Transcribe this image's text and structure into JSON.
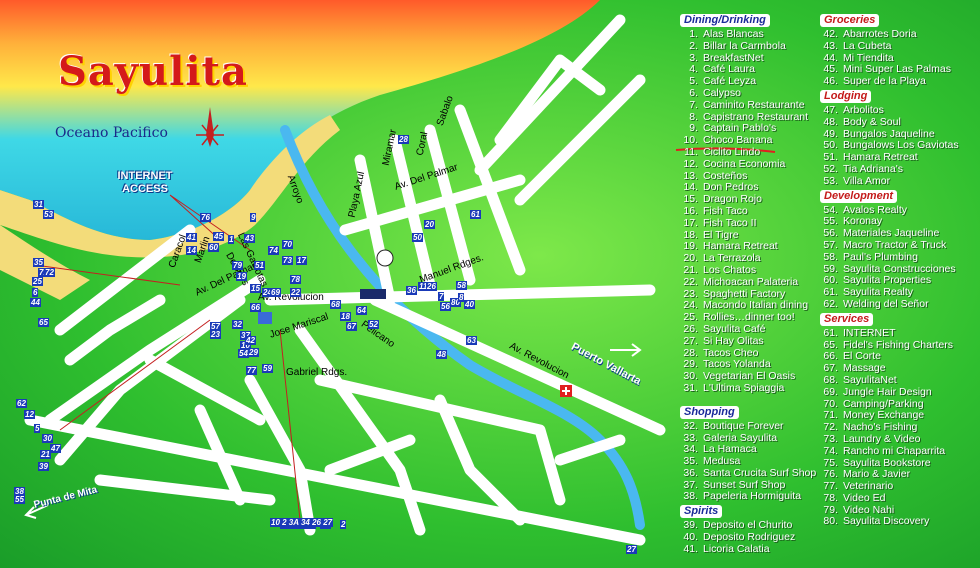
{
  "map": {
    "title": "Sayulita",
    "ocean_label": "Oceano Pacifico",
    "internet_label_line1": "INTERNET",
    "internet_label_line2": "ACCESS",
    "streets": {
      "caracol": "Caracol",
      "marlin": "Marlin",
      "las_gaviotas": "Las Gaviotas",
      "delfines": "Delfines",
      "av_del_palmar_west": "Av. Del Palmar",
      "av_revolucion_west": "Av. Revolucion",
      "jose_mariscal": "Jose Mariscal",
      "gabriel_rdgs": "Gabriel Rdgs.",
      "pelicano": "Pelicano",
      "manuel_rdges": "Manuel Rdges.",
      "av_revolucion_east": "Av. Revolucion",
      "av_del_palmar_east": "Av. Del Palmar",
      "playa_azul": "Playa Azul",
      "miramar": "Miramar",
      "coral": "Coral",
      "sabalo": "Sabalo",
      "arroyo": "Arroyo",
      "puerto_vallarta": "Puerto Vallarta",
      "punta_de_mita": "Punta de Mita"
    },
    "markers": [
      "31",
      "53",
      "76",
      "9",
      "70",
      "43",
      "45",
      "1",
      "35",
      "71",
      "25",
      "6",
      "44",
      "72",
      "65",
      "57",
      "23",
      "37",
      "10",
      "54",
      "62",
      "12",
      "5",
      "30",
      "47",
      "21",
      "39",
      "38",
      "55",
      "41",
      "14",
      "60",
      "79",
      "19",
      "51",
      "15",
      "24",
      "69",
      "74",
      "73",
      "17",
      "78",
      "22",
      "66",
      "32",
      "42",
      "29",
      "77",
      "68",
      "18",
      "67",
      "64",
      "52",
      "28",
      "20",
      "50",
      "7",
      "36",
      "11",
      "26",
      "56",
      "80",
      "40",
      "58",
      "8",
      "63",
      "48",
      "61",
      "59",
      "27",
      "2",
      "3",
      "34",
      "13",
      "46",
      "16"
    ],
    "bottom_markers": "10 2 3A 34 26 27"
  },
  "legend": {
    "dining_title": "Dining/Drinking",
    "dining": [
      [
        "1.",
        "Alas Blancas"
      ],
      [
        "2.",
        "Billar la Carmbola"
      ],
      [
        "3.",
        "BreakfastNet"
      ],
      [
        "4.",
        "Café Laura"
      ],
      [
        "5.",
        "Café Leyza"
      ],
      [
        "6.",
        "Calypso"
      ],
      [
        "7.",
        "Caminito Restaurante"
      ],
      [
        "8.",
        "Capistrano Restaurant"
      ],
      [
        "9.",
        "Captain Pablo's"
      ],
      [
        "10.",
        "Choco Banana"
      ],
      [
        "11.",
        "Ciclito Lindo"
      ],
      [
        "12.",
        "Cocina Economia"
      ],
      [
        "13.",
        "Costeños"
      ],
      [
        "14.",
        "Don Pedros"
      ],
      [
        "15.",
        "Dragon Rojo"
      ],
      [
        "16.",
        "Fish Taco"
      ],
      [
        "17.",
        "Fish Taco II"
      ],
      [
        "18.",
        "El Tigre"
      ],
      [
        "19.",
        "Hamara Retreat"
      ],
      [
        "20.",
        "La Terrazola"
      ],
      [
        "21.",
        "Los Chatos"
      ],
      [
        "22.",
        "Michoacan Palateria"
      ],
      [
        "23.",
        "Spaghetti Factory"
      ],
      [
        "24.",
        "Macondo Italian dining"
      ],
      [
        "25.",
        "Rollies…dinner too!"
      ],
      [
        "26.",
        "Sayulita Café"
      ],
      [
        "27.",
        "Si Hay Olitas"
      ],
      [
        "28.",
        "Tacos Cheo"
      ],
      [
        "29.",
        "Tacos Yolanda"
      ],
      [
        "30.",
        "Vegetarian El Oasis"
      ],
      [
        "31.",
        "L'Ultima Spiaggia"
      ]
    ],
    "shopping_title": "Shopping",
    "shopping": [
      [
        "32.",
        "Boutique Forever"
      ],
      [
        "33.",
        "Galeria Sayulita"
      ],
      [
        "34.",
        "La Hamaca"
      ],
      [
        "35.",
        "Medusa"
      ],
      [
        "36.",
        "Santa Crucita Surf Shop"
      ],
      [
        "37.",
        "Sunset Surf Shop"
      ],
      [
        "38.",
        "Papeleria Hormiguita"
      ]
    ],
    "spirits_title": "Spirits",
    "spirits": [
      [
        "39.",
        "Deposito el Churito"
      ],
      [
        "40.",
        "Deposito Rodriguez"
      ],
      [
        "41.",
        "Licoria Calatia"
      ]
    ],
    "groceries_title": "Groceries",
    "groceries": [
      [
        "42.",
        "Abarrotes Doria"
      ],
      [
        "43.",
        "La Cubeta"
      ],
      [
        "44.",
        "Mi Tiendita"
      ],
      [
        "45.",
        "Mini Super Las Palmas"
      ],
      [
        "46.",
        "Super de la Playa"
      ]
    ],
    "lodging_title": "Lodging",
    "lodging": [
      [
        "47.",
        "Arbolitos"
      ],
      [
        "48.",
        "Body & Soul"
      ],
      [
        "49.",
        "Bungalos Jaqueline"
      ],
      [
        "50.",
        "Bungalows Los Gaviotas"
      ],
      [
        "51.",
        "Hamara Retreat"
      ],
      [
        "52.",
        "Tia Adriana's"
      ],
      [
        "53.",
        "Villa Amor"
      ]
    ],
    "development_title": "Development",
    "development": [
      [
        "54.",
        "Avalos Realty"
      ],
      [
        "55.",
        "Koronay"
      ],
      [
        "56.",
        "Materiales Jaqueline"
      ],
      [
        "57.",
        "Macro Tractor & Truck"
      ],
      [
        "58.",
        "Paul's Plumbing"
      ],
      [
        "59.",
        "Sayulita Construcciones"
      ],
      [
        "60.",
        "Sayulita Properties"
      ],
      [
        "61.",
        "Sayulita Realty"
      ],
      [
        "62.",
        "Welding del Señor"
      ]
    ],
    "services_title": "Services",
    "services": [
      [
        "61.",
        "INTERNET"
      ],
      [
        "65.",
        "Fidel's Fishing Charters"
      ],
      [
        "66.",
        "El Corte"
      ],
      [
        "67.",
        "Massage"
      ],
      [
        "68.",
        "SayulitaNet"
      ],
      [
        "69.",
        "Jungle Hair Design"
      ],
      [
        "70.",
        "Camping/Parking"
      ],
      [
        "71.",
        "Money Exchange"
      ],
      [
        "72.",
        "Nacho's Fishing"
      ],
      [
        "73.",
        "Laundry & Video"
      ],
      [
        "74.",
        "Rancho mi Chaparrita"
      ],
      [
        "75.",
        "Sayulita Bookstore"
      ],
      [
        "76.",
        "Mario & Javier"
      ],
      [
        "77.",
        "Veterinario"
      ],
      [
        "78.",
        "Video Ed"
      ],
      [
        "79.",
        "Video Nahi"
      ],
      [
        "80.",
        "Sayulita Discovery"
      ]
    ]
  },
  "colors": {
    "land": "#2fbf2f",
    "road": "#ffffff",
    "sea_top": "#ff5a2a",
    "sea_mid": "#ffe84a",
    "sea_low": "#3fd8e6",
    "river": "#4ab8f0",
    "title": "#d41a1a",
    "marker": "#1a3ab8"
  }
}
